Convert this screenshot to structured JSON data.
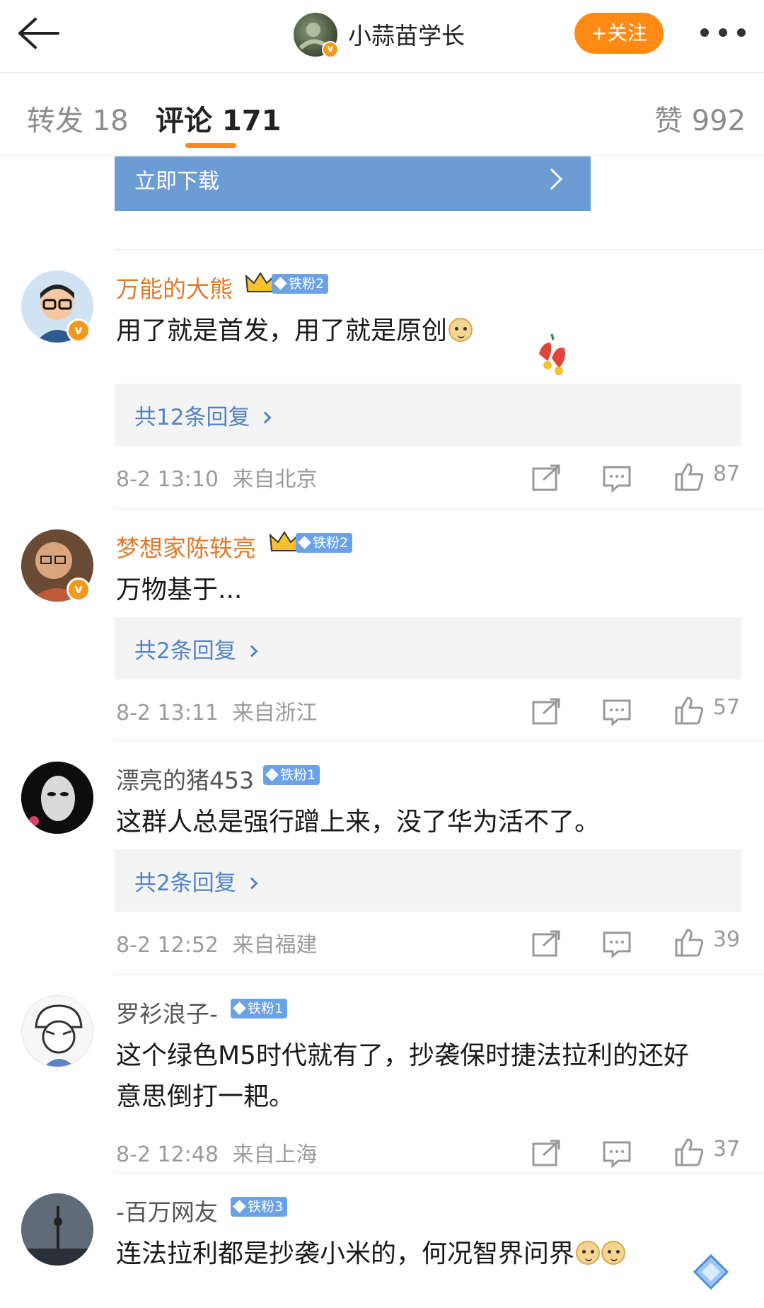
{
  "header": {
    "title": "小蒜苗学长",
    "follow_label": "+关注",
    "back_icon": "back-arrow-icon",
    "more_icon": "more-dots-icon",
    "verified_mark": "v"
  },
  "tabs": [
    {
      "label": "转发 18"
    },
    {
      "label": "评论 171",
      "active": true
    },
    {
      "label": "赞 992"
    }
  ],
  "banner": {
    "label": "立即下载"
  },
  "colors": {
    "accent": "#ff8b16",
    "username": "#e07a2b",
    "link": "#5383c4",
    "banner": "#6d9bd3",
    "fan_badge": "#6aa2e8"
  },
  "comments": [
    {
      "user": "万能的大熊",
      "badge": "铁粉2",
      "text": "用了就是首发，用了就是原创",
      "reply": "共12条回复",
      "time": "8-2 13:10",
      "location": "来自北京",
      "likes": "87"
    },
    {
      "user": "梦想家陈轶亮",
      "badge": "铁粉2",
      "text": "万物基于...",
      "reply": "共2条回复",
      "time": "8-2 13:11",
      "location": "来自浙江",
      "likes": "57"
    },
    {
      "user": "漂亮的猪453",
      "badge": "铁粉1",
      "text": "这群人总是强行蹭上来，没了华为活不了。",
      "reply": "共2条回复",
      "time": "8-2 12:52",
      "location": "来自福建",
      "likes": "39"
    },
    {
      "user": "罗衫浪子-",
      "badge": "铁粉1",
      "text_line1": "这个绿色M5时代就有了，抄袭保时捷法拉利的还好",
      "text_line2": "意思倒打一耙。",
      "time": "8-2 12:48",
      "location": "来自上海",
      "likes": "37"
    },
    {
      "user": "-百万网友",
      "badge": "铁粉3",
      "text": "连法拉利都是抄袭小米的，何况智界问界"
    }
  ]
}
